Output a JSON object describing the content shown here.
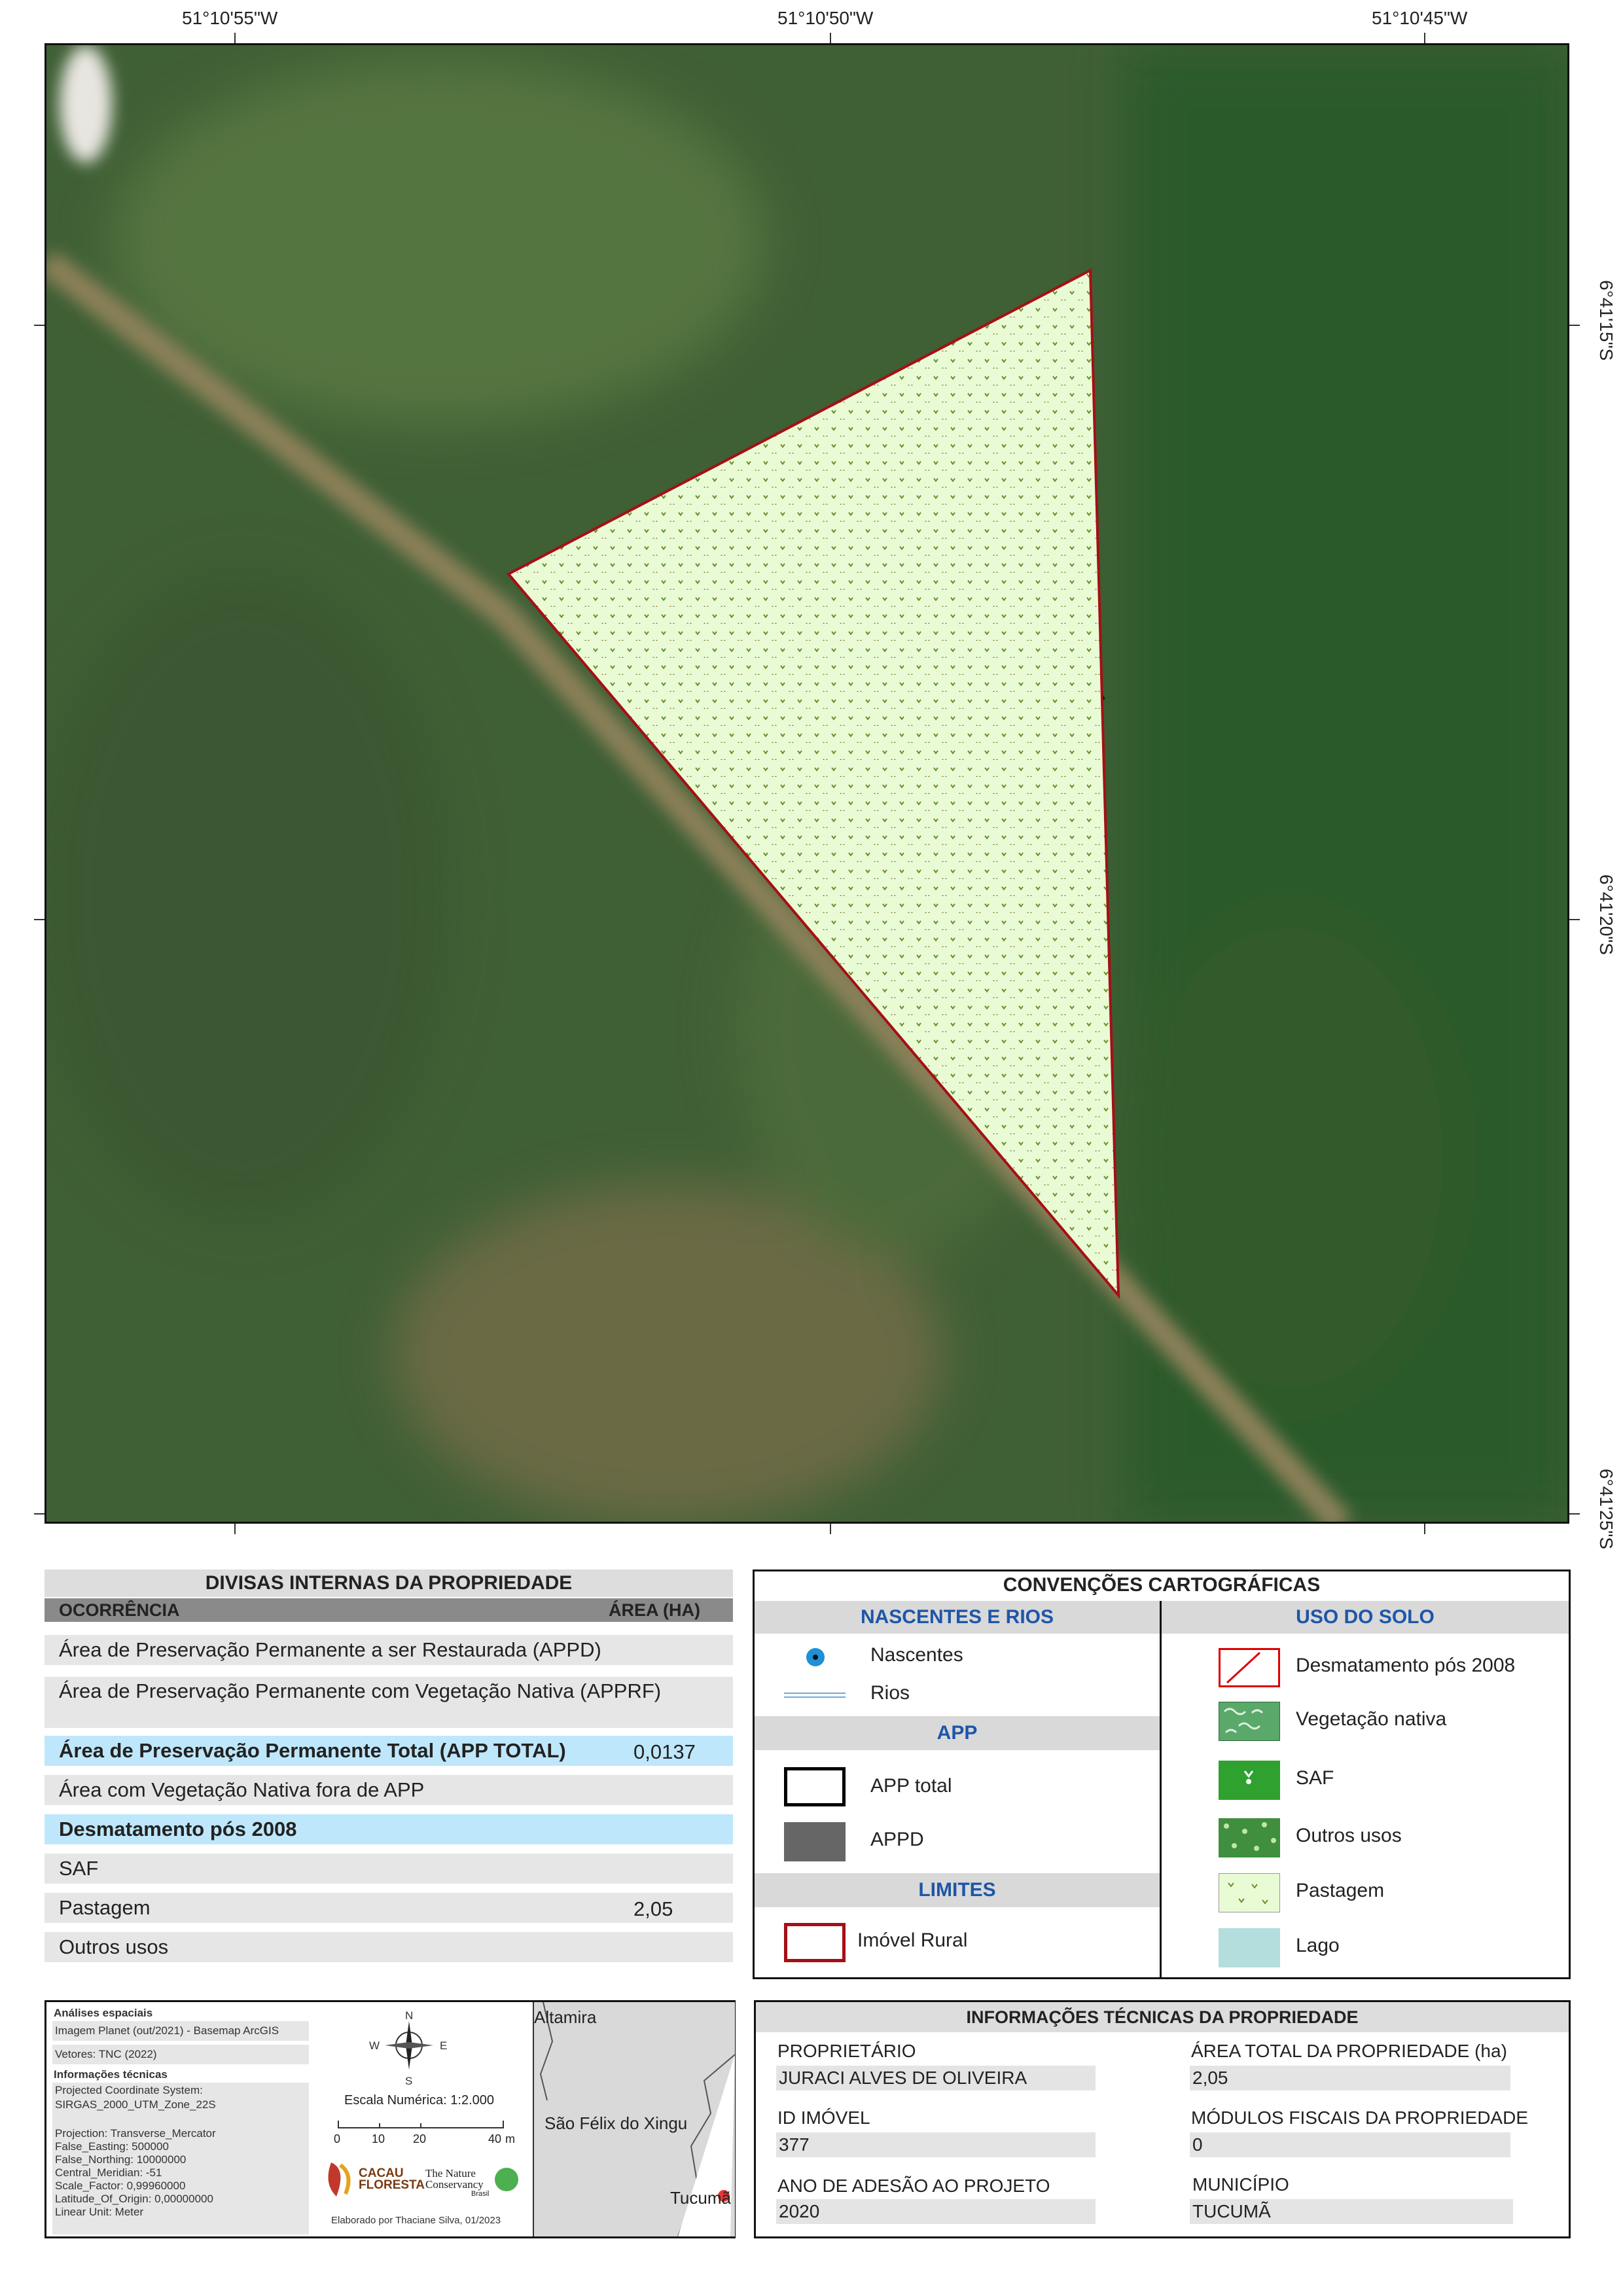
{
  "coordinates": {
    "top": [
      "51°10'55\"W",
      "51°10'50\"W",
      "51°10'45\"W"
    ],
    "right": [
      "6°41'15\"S",
      "6°41'20\"S",
      "6°41'25\"S"
    ]
  },
  "divisas": {
    "title": "DIVISAS INTERNAS DA PROPRIEDADE",
    "col_ocorrencia": "OCORRÊNCIA",
    "col_area": "ÁREA (HA)",
    "rows": [
      {
        "label": "Área de Preservação Permanente a ser Restaurada (APPD)",
        "value": ""
      },
      {
        "label": "Área de Preservação Permanente com Vegetação Nativa (APPRF)",
        "value": ""
      },
      {
        "label": "Área de Preservação Permanente Total (APP TOTAL)",
        "value": "0,0137"
      },
      {
        "label": "Área com Vegetação Nativa fora de APP",
        "value": ""
      },
      {
        "label": "Desmatamento pós 2008",
        "value": ""
      },
      {
        "label": "SAF",
        "value": ""
      },
      {
        "label": "Pastagem",
        "value": "2,05"
      },
      {
        "label": "Outros usos",
        "value": ""
      }
    ]
  },
  "convencoes": {
    "title": "CONVENÇÕES CARTOGRÁFICAS",
    "nascentes_header": "NASCENTES E RIOS",
    "nascentes": "Nascentes",
    "rios": "Rios",
    "app_header": "APP",
    "app_total": "APP total",
    "appd": "APPD",
    "limites_header": "LIMITES",
    "imovel": "Imóvel Rural",
    "uso_header": "USO DO SOLO",
    "uso": [
      "Desmatamento pós 2008",
      "Vegetação nativa",
      "SAF",
      "Outros usos",
      "Pastagem",
      "Lago"
    ]
  },
  "analises": {
    "title": "Análises espaciais",
    "imagem": "Imagem Planet (out/2021) - Basemap ArcGIS",
    "vetores": "Vetores: TNC (2022)",
    "info_title": "Informações técnicas",
    "info_lines": [
      "Projected Coordinate System:",
      "SIRGAS_2000_UTM_Zone_22S",
      "",
      "Projection: Transverse_Mercator",
      "False_Easting: 500000",
      "False_Northing: 10000000",
      "Central_Meridian: -51",
      "Scale_Factor: 0,99960000",
      "Latitude_Of_Origin: 0,00000000",
      "Linear Unit:  Meter"
    ],
    "escala": "Escala Numérica: 1:2.000",
    "scale_ticks": [
      "0",
      "10",
      "20",
      "40"
    ],
    "scale_unit": "m",
    "compass": {
      "n": "N",
      "s": "S",
      "e": "E",
      "w": "W"
    },
    "logo_cacau": "CACAU FLORESTA",
    "logo_tnc": "The Nature Conservancy",
    "logo_tnc_sub": "Brasil",
    "elaborado": "Elaborado por Thaciane Silva, 01/2023"
  },
  "locator": {
    "places": [
      "Altamira",
      "São Félix do Xingu",
      "Tucumã"
    ]
  },
  "tecnicas": {
    "title": "INFORMAÇÕES TÉCNICAS DA PROPRIEDADE",
    "proprietario_label": "PROPRIETÁRIO",
    "proprietario": "JURACI ALVES DE OLIVEIRA",
    "area_label": "ÁREA TOTAL DA PROPRIEDADE (ha)",
    "area": "2,05",
    "id_label": "ID IMÓVEL",
    "id": "377",
    "modulos_label": "MÓDULOS FISCAIS DA PROPRIEDADE",
    "modulos": "0",
    "ano_label": "ANO DE ADESÃO AO PROJETO",
    "ano": "2020",
    "municipio_label": "MUNICÍPIO",
    "municipio": "TUCUMÃ"
  },
  "colors": {
    "border_red": "#a50f15",
    "pastagem_fill": "#e9fbd5",
    "highlight_blue": "#bfe7fb",
    "header_blue": "#1e56a8"
  }
}
